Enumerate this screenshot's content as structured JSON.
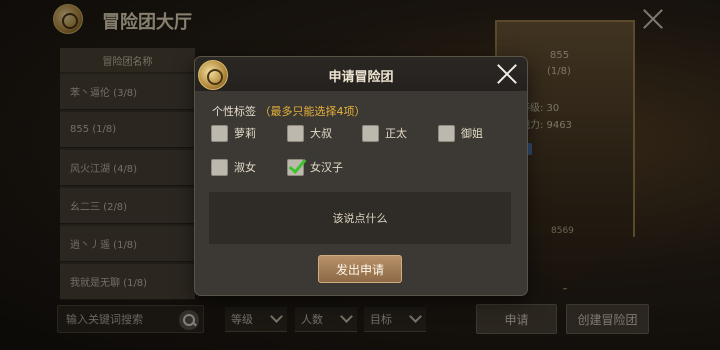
{
  "hall": {
    "title": "冒险团大厅",
    "list_header": "冒险团名称",
    "guilds": [
      "苯丶逼伦 (3/8)",
      "855 (1/8)",
      "风火江湖 (4/8)",
      "幺二三 (2/8)",
      "逍丶丿遥 (1/8)",
      "我就是无聊 (1/8)"
    ],
    "search_placeholder": "输入关键词搜索",
    "filters": [
      "等级",
      "人数",
      "目标"
    ],
    "buttons": {
      "apply": "申请",
      "create": "创建冒险团"
    },
    "crest": {
      "name": "855",
      "count": "(1/8)",
      "avg_level": "均等级: 30",
      "avg_power": "均战力: 9463",
      "footer_number": "8569"
    }
  },
  "modal": {
    "title": "申请冒险团",
    "tags_heading": "个性标签",
    "tags_note": "（最多只能选择4项）",
    "tags": [
      {
        "label": "萝莉",
        "checked": false
      },
      {
        "label": "大叔",
        "checked": false
      },
      {
        "label": "正太",
        "checked": false
      },
      {
        "label": "御姐",
        "checked": false
      },
      {
        "label": "淑女",
        "checked": false
      },
      {
        "label": "女汉子",
        "checked": true
      }
    ],
    "message_placeholder": "该说点什么",
    "submit_label": "发出申请"
  },
  "colors": {
    "accent_gold": "#e5b23a",
    "checkmark_green": "#3ec32f",
    "submit_button": "#a88160"
  }
}
